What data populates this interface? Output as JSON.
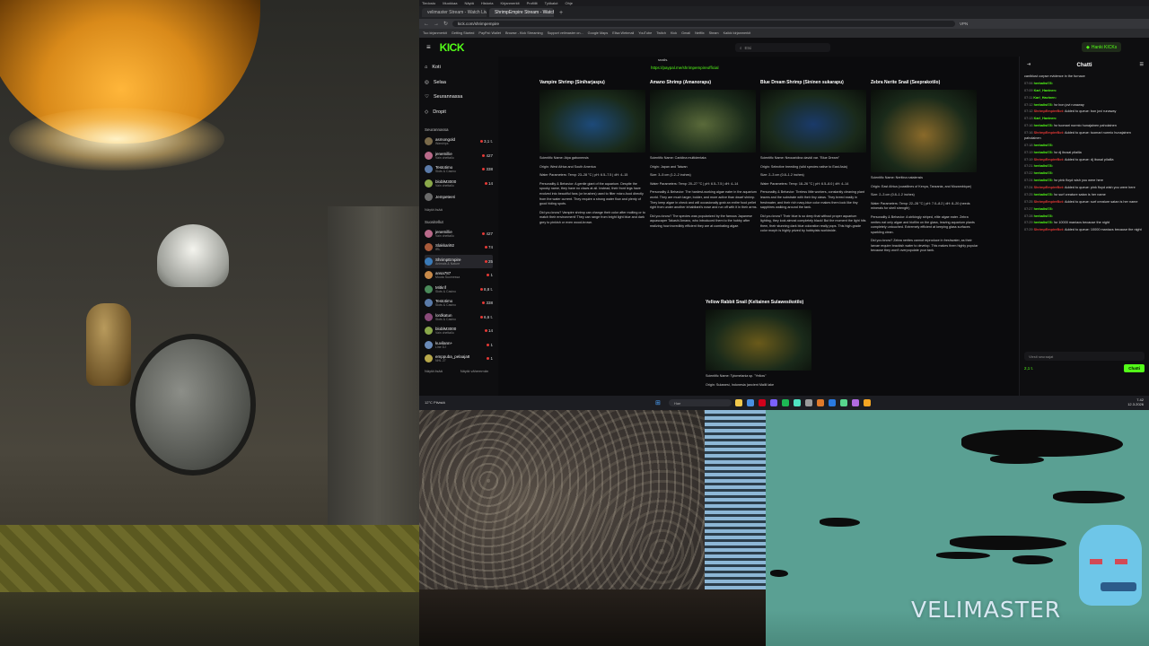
{
  "browser": {
    "menu": [
      "Tiedosto",
      "Muokkaa",
      "Näytä",
      "Historia",
      "Kirjanmerkit",
      "Profiilit",
      "Työkalut",
      "Ohje"
    ],
    "tabs": [
      {
        "label": "velimaster Stream - Watch Live",
        "active": false
      },
      {
        "label": "ShrimpEmpire Stream - Watch Live",
        "active": true
      }
    ],
    "tab_new": "+",
    "url": "kick.com/shrimpempire",
    "vpn": "VPN",
    "bookmarks": [
      "Tuo kirjanmerkit",
      "Getting Started",
      "PayPal: Wallet",
      "Browse - Kick Streaming",
      "Support velimaster on...",
      "Google Maps",
      "Elisa Webmail",
      "YouTube",
      "Twitch",
      "Kick",
      "Gmail",
      "Netflix",
      "Steam",
      "Kaikki kirjanmerkit"
    ]
  },
  "kick": {
    "menu_icon": "≡",
    "logo": "KICK",
    "search_placeholder": "Etsi",
    "login_label": "Hanki KICKs",
    "sidebar": {
      "nav": [
        {
          "icon": "⌂",
          "label": "Koti"
        },
        {
          "icon": "◎",
          "label": "Selaa"
        },
        {
          "icon": "♡",
          "label": "Seurannassa"
        },
        {
          "icon": "◇",
          "label": "Dropit"
        }
      ],
      "following_title": "Seurannassa",
      "following": [
        {
          "name": "asmongold",
          "category": "Warships",
          "count": "3,1 t.",
          "color": "#7a6a4a"
        },
        {
          "name": "jenemillie",
          "category": "Vain chettailu",
          "count": "427",
          "color": "#b96a8a"
        },
        {
          "name": "Testotimo",
          "category": "Slots & Casino",
          "count": "338",
          "color": "#5a7aa8"
        },
        {
          "name": "bloblM3000",
          "category": "Vain chettailu",
          "count": "14",
          "color": "#8aa84a"
        },
        {
          "name": "Jempeteeri",
          "category": "",
          "count": "",
          "color": "#6a6a6a"
        }
      ],
      "more1": "Näytä lisää",
      "recommended_title": "Suositellut",
      "recommended": [
        {
          "name": "jenemillie",
          "category": "Vain chettailu",
          "count": "427",
          "color": "#b96a8a",
          "active": false
        },
        {
          "name": "Slakkari92",
          "category": "IRL",
          "count": "74",
          "color": "#a85a3a",
          "active": false
        },
        {
          "name": "ShrimpEmpire",
          "category": "Animals & Nature",
          "count": "25",
          "color": "#3a7ab8",
          "active": true
        },
        {
          "name": "ansa787",
          "category": "Muuta Suomessa",
          "count": "1",
          "color": "#c88a4a",
          "active": false
        },
        {
          "name": "Mitkrif",
          "category": "Slots & Casino",
          "count": "8,8 t.",
          "color": "#4a8a5a",
          "active": false
        },
        {
          "name": "Testotimo",
          "category": "Slots & Casino",
          "count": "338",
          "color": "#5a7aa8",
          "active": false
        },
        {
          "name": "lordkatun",
          "category": "Slots & Casino",
          "count": "6,6 t.",
          "color": "#8a4a7a",
          "active": false
        },
        {
          "name": "bloblM3000",
          "category": "Vain chettailu",
          "count": "14",
          "color": "#8aa84a",
          "active": false
        },
        {
          "name": "kuvilann+",
          "category": "Line DJ",
          "count": "1",
          "color": "#6a8ab8",
          "active": false
        },
        {
          "name": "emppuba_pelaaja8",
          "category": "NHL 27",
          "count": "1",
          "color": "#b8a84a",
          "active": false
        }
      ],
      "more2": "Näytä lisää",
      "less2": "Näytä vähemmän"
    },
    "content": {
      "paypal_top": "snails.",
      "paypal_link": "https://paypal.me/shrimpempireofficial",
      "cards": [
        {
          "title": "Vampire Shrimp (Siniharjaspu)",
          "img_color": "#1d4a7a",
          "lines": [
            "Scientific Name: Atya gabonensis",
            "Origin: West Africa and South America",
            "Water Parameters: Temp: 23–28 °C | pH: 6.5–7.5 | dH: 4–15",
            "Personality & Behavior: A gentle giant of the aquarium. Despite the spooky name, they have no claws at all. Instead, their front legs have evolved into beautiful fans (or brushes) used to filter micro-food directly from the water current. They require a strong water flow and plenty of good hiding spots.",
            "Did you know? Vampire shrimp can change their color after molting or to match their environment! They can range from bright light blue and dark grey to pinkish or even wood-brown."
          ]
        },
        {
          "title": "Amano Shrimp (Amanorapu)",
          "img_color": "#5a6a3a",
          "lines": [
            "Scientific Name: Caridina multidentata",
            "Origin: Japan and Taiwan",
            "Size: 3–5 cm (1.2–2 inches)",
            "Water Parameters: Temp: 20–27 °C | pH: 6.5–7.5 | dH: 4–14",
            "Personality & Behavior: The hardest-working algae eater in the aquarium world. They are much larger, bolder, and more active than dwarf shrimp. They keep algae in check and will occasionally grab an entire food pellet right from under another inhabitant's nose and run off with it in their arms.",
            "Did you know? The species was popularized by the famous Japanese aquascaper Takashi Amano, who introduced them to the hobby after realizing how incredibly efficient they are at combating algae."
          ]
        },
        {
          "title": "Blue Dream Shrimp (Sininen sukarapu)",
          "img_color": "#1a3a6a",
          "lines": [
            "Scientific Name: Neocaridina davidi var. \"Blue Dream\"",
            "Origin: Selective breeding (wild species native to East Asia)",
            "Size: 2–3 cm (0.8–1.2 inches)",
            "Water Parameters: Temp: 18–26 °C | pH: 6.5–8.0 | dH: 4–14",
            "Personality & Behavior: Tireless little workers, constantly cleaning plant leaves and the substrate with their tiny claws. They breed easily in freshwater, and their rich navy-blue color makes them look like tiny sapphires walking around the tank.",
            "Did you know? Their blue is so deep that without proper aquarium lighting, they look almost completely black! But the moment the light hits them, their stunning dark blue coloration really pops. This high-grade color morph is highly prized by hobbyists worldwide."
          ]
        },
        {
          "title": "Zebra Nerite Snail (Seeprakotilo)",
          "img_color": "#8a6a2a",
          "lines": [
            "Scientific Name: Neritina natalensis",
            "Origin: East Africa (coastlines of Kenya, Tanzania, and Mozambique)",
            "Size: 2–3 cm (0.8–1.2 inches)",
            "Water Parameters: Temp: 22–28 °C | pH: 7.0–8.2 | dH: 8–20 (needs minerals for shell strength)",
            "Personality & Behavior: A strikingly striped, elite algae eater. Zebra nerites eat only algae and biofilm on the glass, leaving aquarium plants completely untouched. Extremely efficient at keeping glass surfaces sparkling clean.",
            "Did you know? Zebra nerites cannot reproduce in freshwater, as their larvae require brackish water to develop. This makes them highly popular because they won't overpopulate your tank."
          ]
        },
        {
          "title": "Yellow Rabbit Snail (Keltainen Sulawesikotilo)",
          "img_color": "#6a5a1a",
          "lines": [
            "Scientific Name: Tylomelania sp. \"Yellow\"",
            "Origin: Sulawesi, Indonesia (ancient Malili lake"
          ]
        }
      ]
    },
    "chat": {
      "title": "Chatti",
      "collapse_icon": "⇥",
      "users_icon": "☰",
      "messages": [
        {
          "time": "",
          "user": "",
          "color": "#ddd",
          "text": "caniblust corpse evidence in the furnace"
        },
        {
          "time": "07:06",
          "user": "herbalist78:",
          "color": "#53fc18",
          "text": ""
        },
        {
          "time": "07:09",
          "user": "Karl_Havinen:",
          "color": "#53fc18",
          "text": ""
        },
        {
          "time": "07:11",
          "user": "Karl_Havinen:",
          "color": "#53fc18",
          "text": ""
        },
        {
          "time": "07:12",
          "user": "herbalist78:",
          "color": "#53fc18",
          "text": "!sr bon jovi runaway"
        },
        {
          "time": "07:12",
          "user": "ShrimpEmpireBot:",
          "color": "#e53935",
          "text": "Added to queue: bon jovi runaway"
        },
        {
          "time": "07:13",
          "user": "Karl_Havinen:",
          "color": "#53fc18",
          "text": ""
        },
        {
          "time": "07:16",
          "user": "herbalist78:",
          "color": "#53fc18",
          "text": "!sr tuomari nurmio hunajainen paholainen"
        },
        {
          "time": "07:16",
          "user": "ShrimpEmpireBot:",
          "color": "#e53935",
          "text": "Added to queue: tuomari nurmio hunajainen paholainen"
        },
        {
          "time": "07:18",
          "user": "herbalist78:",
          "color": "#53fc18",
          "text": ""
        },
        {
          "time": "07:19",
          "user": "herbalist78:",
          "color": "#53fc18",
          "text": "!sr dj ibusal pilailla"
        },
        {
          "time": "07:19",
          "user": "ShrimpEmpireBot:",
          "color": "#e53935",
          "text": "Added to queue: dj ibusal pilailla"
        },
        {
          "time": "07:21",
          "user": "herbalist78:",
          "color": "#53fc18",
          "text": ""
        },
        {
          "time": "07:22",
          "user": "herbalist78:",
          "color": "#53fc18",
          "text": ""
        },
        {
          "time": "07:24",
          "user": "herbalist78:",
          "color": "#53fc18",
          "text": "!sr pink floyd wish you were here"
        },
        {
          "time": "07:24",
          "user": "ShrimpEmpireBot:",
          "color": "#e53935",
          "text": "Added to queue: pink floyd wish you were here"
        },
        {
          "time": "07:25",
          "user": "herbalist78:",
          "color": "#53fc18",
          "text": "!sr surf creature satan is her name"
        },
        {
          "time": "07:25",
          "user": "ShrimpEmpireBot:",
          "color": "#e53935",
          "text": "Added to queue: surf creature satan is her name"
        },
        {
          "time": "07:27",
          "user": "herbalist78:",
          "color": "#53fc18",
          "text": ""
        },
        {
          "time": "07:28",
          "user": "herbalist78:",
          "color": "#53fc18",
          "text": ""
        },
        {
          "time": "07:29",
          "user": "herbalist78:",
          "color": "#53fc18",
          "text": "!sr 10000 maniacs because the night"
        },
        {
          "time": "07:29",
          "user": "ShrimpEmpireBot:",
          "color": "#e53935",
          "text": "Added to queue: 10000 maniacs because the night"
        }
      ],
      "input_placeholder": "Viesti seuraajat",
      "points": "2,1 t.",
      "send_label": "Chatti"
    }
  },
  "taskbar": {
    "weather": "12°C Pilvistä",
    "search_placeholder": "Hae",
    "clock": "7.42",
    "date": "12.3.2026",
    "app_colors": [
      "#f2c94c",
      "#4a90e2",
      "#d0021b",
      "#7b61ff",
      "#1db954",
      "#50e3c2",
      "#9b9b9b",
      "#e07a2a",
      "#2a7ae0",
      "#58d68d",
      "#b06ae0",
      "#f5a623"
    ]
  },
  "overlay": {
    "streamer_name": "VELIMASTER"
  }
}
